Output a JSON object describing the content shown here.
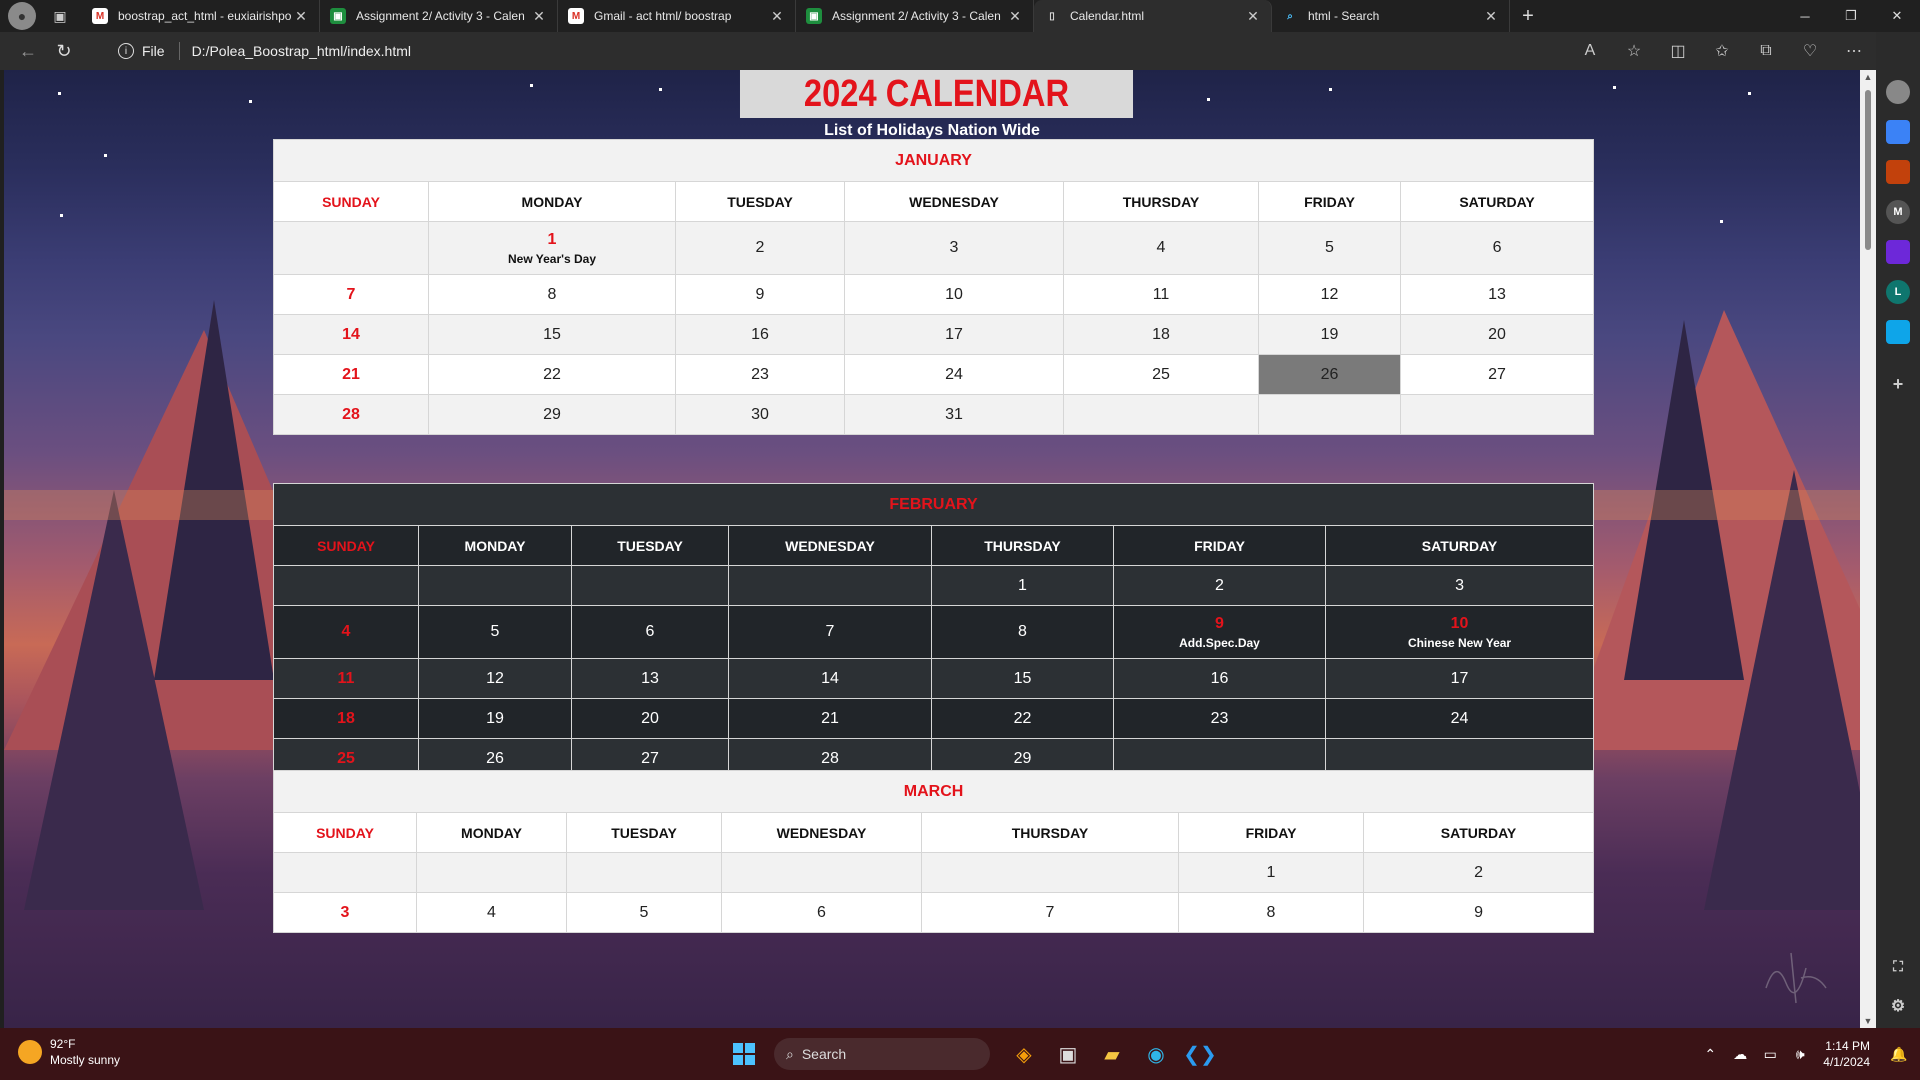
{
  "browser": {
    "tabs": [
      {
        "title": "boostrap_act_html - euxiairishpo",
        "icon": "gmail-icon"
      },
      {
        "title": "Assignment 2/ Activity 3 - Calen",
        "icon": "classroom-icon"
      },
      {
        "title": "Gmail - act html/ boostrap",
        "icon": "gmail-icon"
      },
      {
        "title": "Assignment 2/ Activity 3 - Calen",
        "icon": "classroom-icon"
      },
      {
        "title": "Calendar.html",
        "icon": "file-icon",
        "active": true
      },
      {
        "title": "html - Search",
        "icon": "search-icon"
      }
    ],
    "address": {
      "scheme": "File",
      "url": "D:/Polea_Boostrap_html/index.html"
    }
  },
  "page": {
    "title": "2024 CALENDAR",
    "subtitle": "List of Holidays Nation Wide",
    "weekdays": [
      "SUNDAY",
      "MONDAY",
      "TUESDAY",
      "WEDNESDAY",
      "THURSDAY",
      "FRIDAY",
      "SATURDAY"
    ],
    "months": [
      {
        "name": "JANUARY",
        "theme": "light",
        "weeks": [
          [
            {
              "d": ""
            },
            {
              "d": "1",
              "h": "New Year's Day"
            },
            {
              "d": "2"
            },
            {
              "d": "3"
            },
            {
              "d": "4"
            },
            {
              "d": "5"
            },
            {
              "d": "6"
            }
          ],
          [
            {
              "d": "7"
            },
            {
              "d": "8"
            },
            {
              "d": "9"
            },
            {
              "d": "10"
            },
            {
              "d": "11"
            },
            {
              "d": "12"
            },
            {
              "d": "13"
            }
          ],
          [
            {
              "d": "14"
            },
            {
              "d": "15"
            },
            {
              "d": "16"
            },
            {
              "d": "17"
            },
            {
              "d": "18"
            },
            {
              "d": "19"
            },
            {
              "d": "20"
            }
          ],
          [
            {
              "d": "21"
            },
            {
              "d": "22"
            },
            {
              "d": "23"
            },
            {
              "d": "24"
            },
            {
              "d": "25"
            },
            {
              "d": "26",
              "highlight": true
            },
            {
              "d": "27"
            }
          ],
          [
            {
              "d": "28"
            },
            {
              "d": "29"
            },
            {
              "d": "30"
            },
            {
              "d": "31"
            },
            {
              "d": ""
            },
            {
              "d": ""
            },
            {
              "d": ""
            }
          ]
        ]
      },
      {
        "name": "FEBRUARY",
        "theme": "dark",
        "weeks": [
          [
            {
              "d": ""
            },
            {
              "d": ""
            },
            {
              "d": ""
            },
            {
              "d": ""
            },
            {
              "d": "1"
            },
            {
              "d": "2"
            },
            {
              "d": "3"
            }
          ],
          [
            {
              "d": "4"
            },
            {
              "d": "5"
            },
            {
              "d": "6"
            },
            {
              "d": "7"
            },
            {
              "d": "8"
            },
            {
              "d": "9",
              "h": "Add.Spec.Day"
            },
            {
              "d": "10",
              "h": "Chinese New Year"
            }
          ],
          [
            {
              "d": "11"
            },
            {
              "d": "12"
            },
            {
              "d": "13"
            },
            {
              "d": "14"
            },
            {
              "d": "15"
            },
            {
              "d": "16"
            },
            {
              "d": "17"
            }
          ],
          [
            {
              "d": "18"
            },
            {
              "d": "19"
            },
            {
              "d": "20"
            },
            {
              "d": "21"
            },
            {
              "d": "22"
            },
            {
              "d": "23"
            },
            {
              "d": "24"
            }
          ],
          [
            {
              "d": "25"
            },
            {
              "d": "26"
            },
            {
              "d": "27"
            },
            {
              "d": "28"
            },
            {
              "d": "29"
            },
            {
              "d": ""
            },
            {
              "d": ""
            }
          ]
        ]
      },
      {
        "name": "MARCH",
        "theme": "light",
        "weeks": [
          [
            {
              "d": ""
            },
            {
              "d": ""
            },
            {
              "d": ""
            },
            {
              "d": ""
            },
            {
              "d": ""
            },
            {
              "d": "1"
            },
            {
              "d": "2"
            }
          ],
          [
            {
              "d": "3"
            },
            {
              "d": "4"
            },
            {
              "d": "5"
            },
            {
              "d": "6"
            },
            {
              "d": "7"
            },
            {
              "d": "8"
            },
            {
              "d": "9"
            }
          ]
        ]
      }
    ]
  },
  "taskbar": {
    "weather": {
      "temp": "92°F",
      "desc": "Mostly sunny"
    },
    "search_placeholder": "Search",
    "time": "1:14 PM",
    "date": "4/1/2024"
  },
  "colors": {
    "accent_red": "#e3131b",
    "dark_table": "#212529",
    "highlight_cell": "#7a7a7a"
  }
}
